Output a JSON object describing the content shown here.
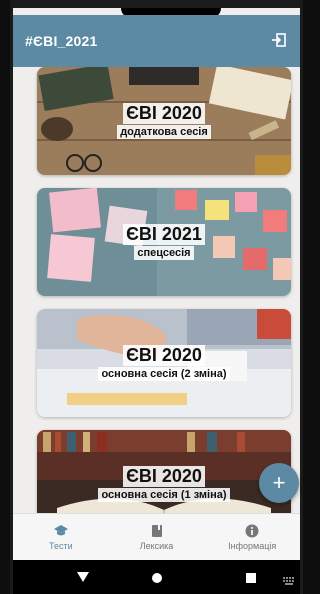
{
  "app": {
    "title": "#ЄВІ_2021"
  },
  "cards": [
    {
      "title": "ЄВІ 2020",
      "subtitle": "додаткова сесія"
    },
    {
      "title": "ЄВІ 2021",
      "subtitle": "спецсесія"
    },
    {
      "title": "ЄВІ 2020",
      "subtitle": "основна сесія (2 зміна)"
    },
    {
      "title": "ЄВІ 2020",
      "subtitle": "основна сесія (1 зміна)"
    }
  ],
  "fab": {
    "icon": "plus-icon",
    "label": "+"
  },
  "bottom_nav": [
    {
      "label": "Тести",
      "icon": "graduation-cap-icon",
      "active": true
    },
    {
      "label": "Лексика",
      "icon": "book-icon",
      "active": false
    },
    {
      "label": "Інформація",
      "icon": "info-icon",
      "active": false
    }
  ],
  "colors": {
    "primary": "#5c8aa5",
    "background": "#efeeec"
  }
}
